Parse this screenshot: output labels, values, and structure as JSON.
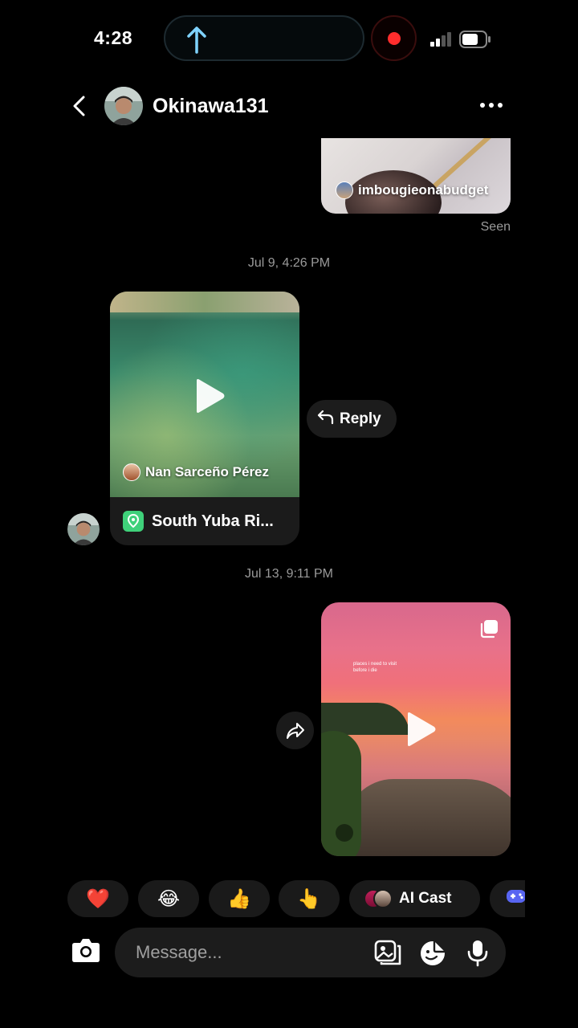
{
  "status_bar": {
    "time": "4:28"
  },
  "header": {
    "username": "Okinawa131"
  },
  "messages": {
    "shared_post_user": "imbougieonabudget",
    "seen_label": "Seen",
    "timestamp_1": "Jul 9, 4:26 PM",
    "reel_author": "Nan Sarceño Pérez",
    "reel_location": "South Yuba Ri...",
    "reply_label": "Reply",
    "timestamp_2": "Jul 13, 9:11 PM",
    "reel2_caption": "places i need to visit before i die"
  },
  "reactions": [
    {
      "emoji": "❤️",
      "name": "heart"
    },
    {
      "emoji": "😂",
      "name": "laughing"
    },
    {
      "emoji": "👍",
      "name": "thumbs-up"
    },
    {
      "emoji": "👆",
      "name": "pointing-up"
    }
  ],
  "ai_cast_label": "AI Cast",
  "composer": {
    "placeholder": "Message..."
  },
  "colors": {
    "background": "#000000",
    "bubble": "#1c1c1c",
    "muted_text": "#9a9a9a",
    "location_pin": "#3fd17a",
    "recording": "#ff2d2d"
  }
}
